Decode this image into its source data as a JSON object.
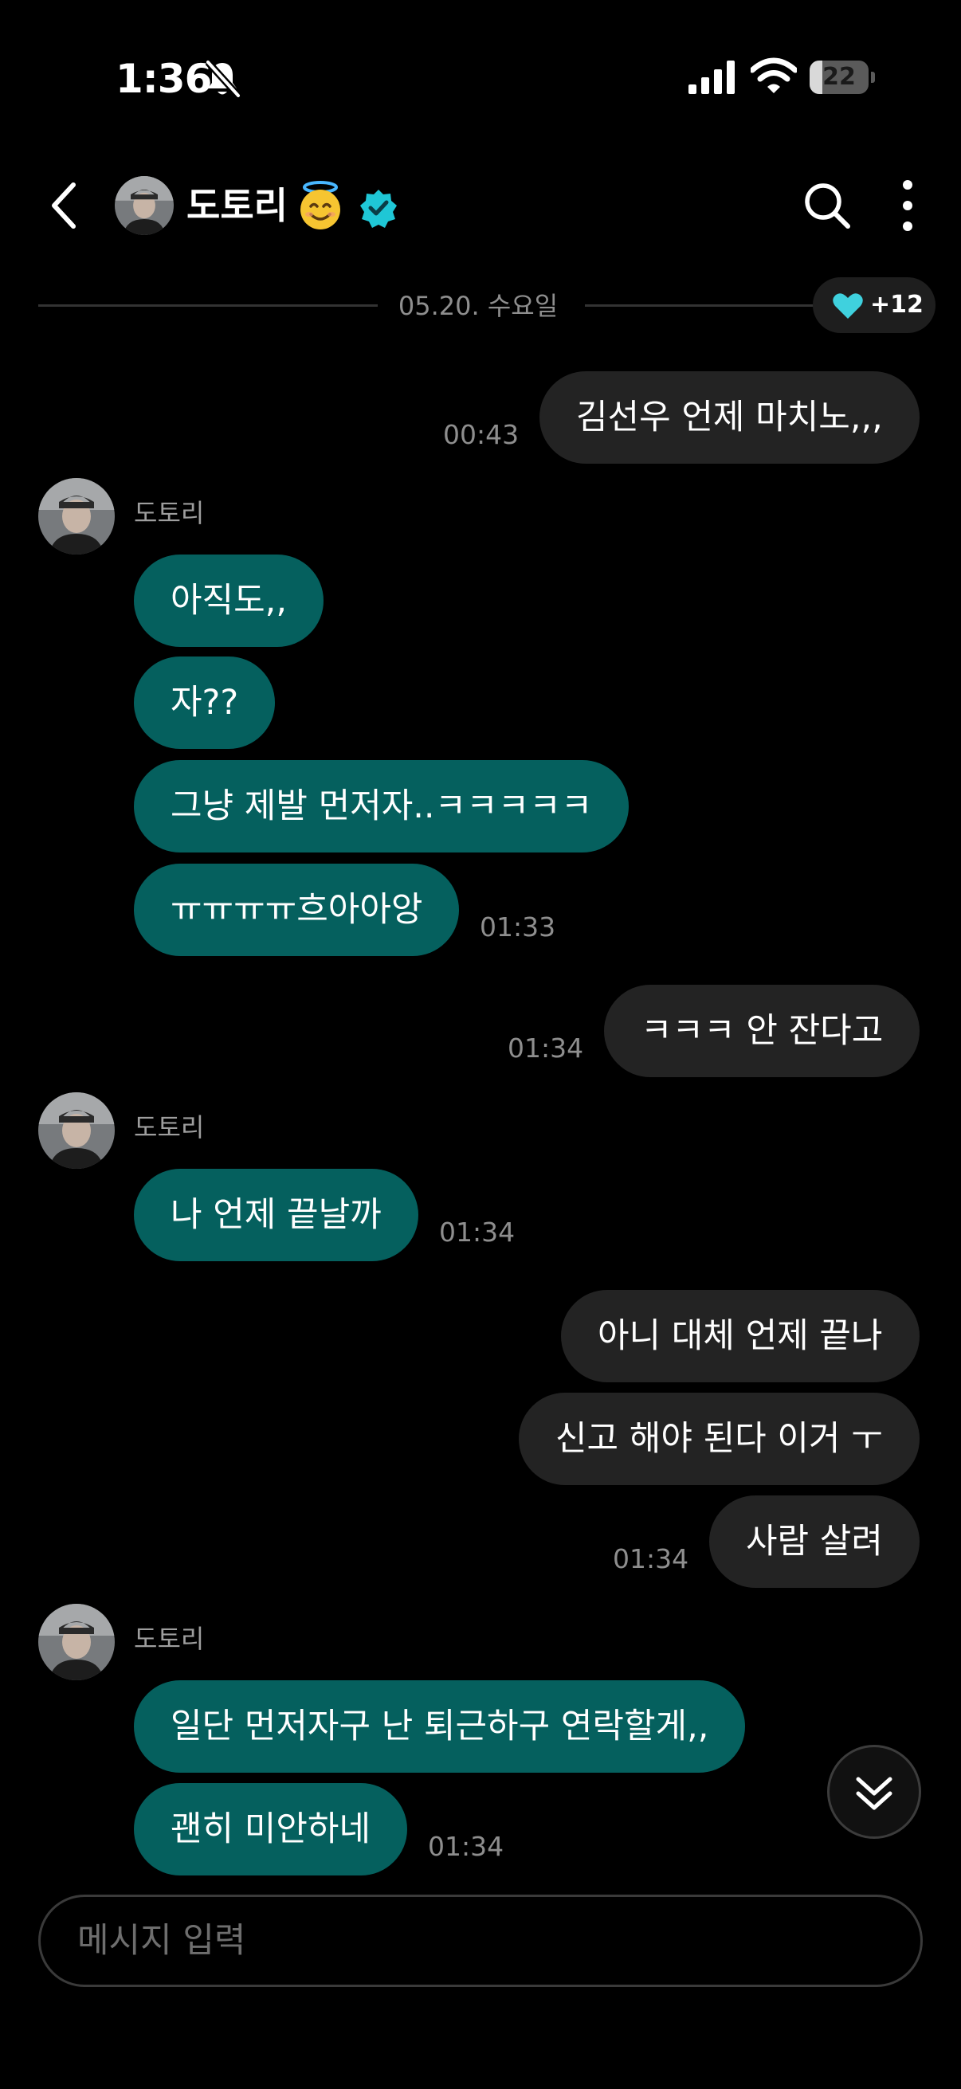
{
  "status_bar": {
    "time": "1:36",
    "battery": "22",
    "battery_level": 0.22
  },
  "header": {
    "name": "도토리"
  },
  "date_divider": {
    "label": "05.20. 수요일"
  },
  "reaction": {
    "count": "+12"
  },
  "messages": [
    {
      "dir": "out",
      "text": "김선우 언제 마치노,,,",
      "time": "00:43"
    },
    {
      "dir": "in",
      "sender": "도토리",
      "text": "아직도,,"
    },
    {
      "dir": "in",
      "text": "자??"
    },
    {
      "dir": "in",
      "text": "그냥 제발 먼저자..ㅋㅋㅋㅋㅋ"
    },
    {
      "dir": "in",
      "text": "ㅠㅠㅠㅠ흐아아앙",
      "time": "01:33"
    },
    {
      "dir": "out",
      "text": "ㅋㅋㅋ 안 잔다고",
      "time": "01:34"
    },
    {
      "dir": "in",
      "sender": "도토리",
      "text": "나 언제 끝날까",
      "time": "01:34"
    },
    {
      "dir": "out",
      "text": "아니 대체 언제 끝나"
    },
    {
      "dir": "out",
      "text": "신고 해야 된다 이거 ㅜ"
    },
    {
      "dir": "out",
      "text": "사람 살려",
      "time": "01:34"
    },
    {
      "dir": "in",
      "sender": "도토리",
      "text": "일단 먼저자구 난 퇴근하구 연락할게,,"
    },
    {
      "dir": "in",
      "text": "괜히 미안하네",
      "time": "01:34"
    }
  ],
  "input": {
    "placeholder": "메시지 입력"
  },
  "colors": {
    "incoming_bubble": "#05605e",
    "outgoing_bubble": "#232323",
    "verified": "#1fc7d6",
    "heart": "#3fd1de"
  }
}
